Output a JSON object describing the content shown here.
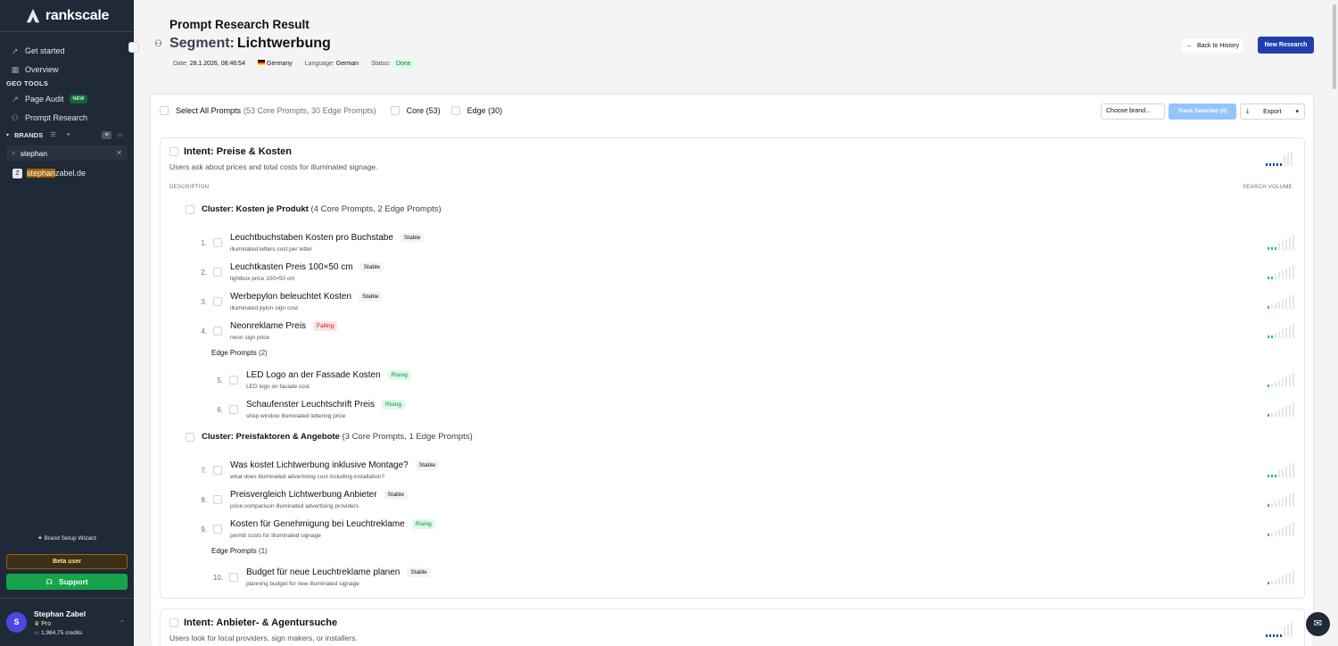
{
  "app": {
    "logo_text": "rankscale"
  },
  "sidebar": {
    "nav": [
      {
        "label": "Get started",
        "icon": "rocket-icon"
      },
      {
        "label": "Overview",
        "icon": "grid-icon"
      }
    ],
    "geo_tools_label": "GEO TOOLS",
    "geo_tools": [
      {
        "label": "Page Audit",
        "icon": "trend-icon",
        "badge": "NEW"
      },
      {
        "label": "Prompt Research",
        "icon": "people-icon"
      }
    ],
    "brands_label": "BRANDS",
    "brand_search_value": "stephan",
    "brand_item": {
      "match": "stephan",
      "rest": "zabel.de"
    },
    "wizard_label": "Brand Setup Wizard",
    "beta_label": "Beta user",
    "support_label": "Support",
    "user": {
      "initial": "S",
      "name": "Stephan Zabel",
      "plan": "Pro",
      "credits": "1,984,75 credits"
    }
  },
  "header": {
    "title": "Prompt Research Result",
    "segment_label": "Segment:",
    "segment_value": "Lichtwerbung",
    "date_label": "Date:",
    "date_value": "28.1.2026, 08:46:54",
    "country": "Germany",
    "language_label": "Language:",
    "language_value": "German",
    "status_label": "Status:",
    "status_value": "Done",
    "back_label": "Back to History",
    "new_label": "New Research"
  },
  "toolbar": {
    "select_all": "Select All Prompts",
    "select_all_count": "(53 Core Prompts, 30 Edge Prompts)",
    "core": "Core (53)",
    "edge": "Edge (30)",
    "choose_brand": "Choose brand...",
    "track": "Track Selected (0)",
    "export": "Export"
  },
  "intents": [
    {
      "title": "Intent: Preise & Kosten",
      "desc": "Users ask about prices and total costs for illuminated signage.",
      "col_description": "DESCRIPTION",
      "col_volume": "SEARCH VOLUME",
      "volume_level": 5,
      "clusters": [
        {
          "name": "Cluster: Kosten je Produkt",
          "count": "(4 Core Prompts, 2 Edge Prompts)",
          "core": [
            {
              "num": "1.",
              "title": "Leuchtbuchstaben Kosten pro Buchstabe",
              "sub": "illuminated letters cost per letter",
              "trend": "Stable",
              "volume_level": 3
            },
            {
              "num": "2.",
              "title": "Leuchtkasten Preis 100×50 cm",
              "sub": "lightbox price 100×50 cm",
              "trend": "Stable",
              "volume_level": 2
            },
            {
              "num": "3.",
              "title": "Werbepylon beleuchtet Kosten",
              "sub": "illuminated pylon sign cost",
              "trend": "Stable",
              "volume_level": 1
            },
            {
              "num": "4.",
              "title": "Neonreklame Preis",
              "sub": "neon sign price",
              "trend": "Falling",
              "volume_level": 2
            }
          ],
          "edge_label": "Edge Prompts",
          "edge_count": "(2)",
          "edge": [
            {
              "num": "5.",
              "title": "LED Logo an der Fassade Kosten",
              "sub": "LED logo on facade cost",
              "trend": "Rising",
              "volume_level": 1
            },
            {
              "num": "6.",
              "title": "Schaufenster Leuchtschrift Preis",
              "sub": "shop window illuminated lettering price",
              "trend": "Rising",
              "volume_level": 1
            }
          ]
        },
        {
          "name": "Cluster: Preisfaktoren & Angebote",
          "count": "(3 Core Prompts, 1 Edge Prompts)",
          "core": [
            {
              "num": "7.",
              "title": "Was kostet Lichtwerbung inklusive Montage?",
              "sub": "what does illuminated advertising cost including installation?",
              "trend": "Stable",
              "volume_level": 3
            },
            {
              "num": "8.",
              "title": "Preisvergleich Lichtwerbung Anbieter",
              "sub": "price comparison illuminated advertising providers",
              "trend": "Stable",
              "volume_level": 1
            },
            {
              "num": "9.",
              "title": "Kosten für Genehmigung bei Leuchtreklame",
              "sub": "permit costs for illuminated signage",
              "trend": "Rising",
              "volume_level": 1
            }
          ],
          "edge_label": "Edge Prompts",
          "edge_count": "(1)",
          "edge": [
            {
              "num": "10.",
              "title": "Budget für neue Leuchtreklame planen",
              "sub": "planning budget for new illuminated signage",
              "trend": "Stable",
              "volume_level": 1
            }
          ]
        }
      ]
    },
    {
      "title": "Intent: Anbieter- & Agentursuche",
      "desc": "Users look for local providers, sign makers, or installers.",
      "volume_level": 5
    }
  ],
  "colors": {
    "sidebar_bg": "#1f2937",
    "primary": "#1e40af",
    "support": "#16a34a",
    "rising": "#15803d",
    "falling": "#b91c1c"
  }
}
